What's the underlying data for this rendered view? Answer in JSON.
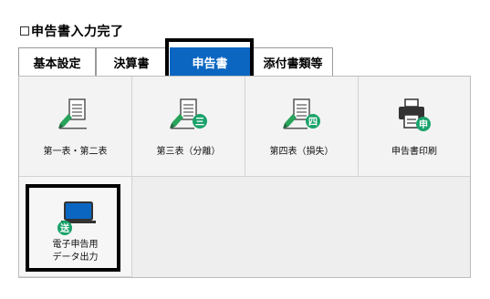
{
  "completion": {
    "label": "申告書入力完了"
  },
  "tabs": [
    {
      "label": "基本設定"
    },
    {
      "label": "決算書"
    },
    {
      "label": "申告書"
    },
    {
      "label": "添付書類等"
    }
  ],
  "cards": [
    {
      "label": "第一表・第二表"
    },
    {
      "label": "第三表（分離）",
      "badge": "三"
    },
    {
      "label": "第四表（損失）",
      "badge": "四"
    },
    {
      "label": "申告書印刷",
      "badge": "申"
    },
    {
      "label_line1": "電子申告用",
      "label_line2": "データ出力",
      "badge": "送"
    }
  ],
  "colors": {
    "accent_blue": "#0b66c2",
    "badge_green": "#1aa36b",
    "pen_green": "#27a35a"
  }
}
